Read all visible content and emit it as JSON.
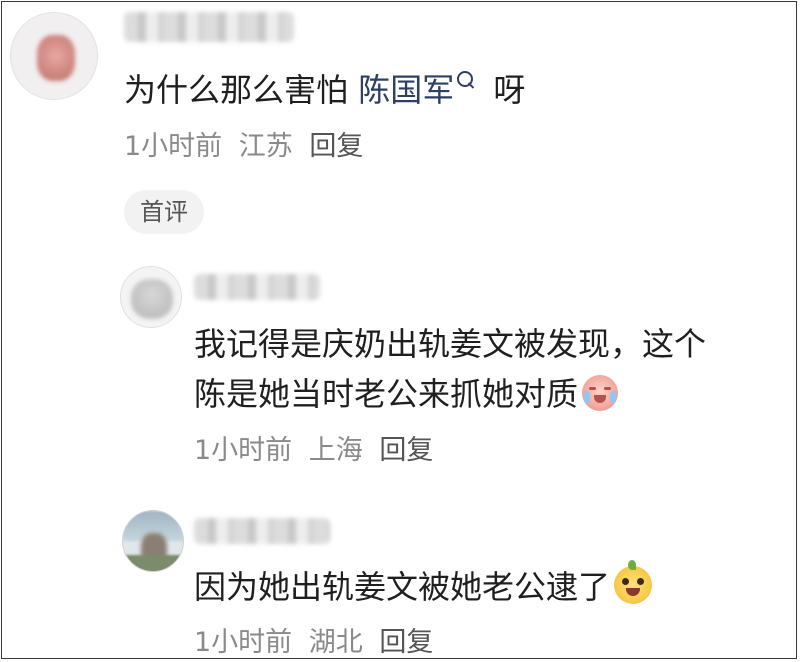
{
  "comments": [
    {
      "text_before_link": "为什么那么害怕 ",
      "link_text": "陈国军",
      "text_after_link": " 呀",
      "meta": {
        "time": "1小时前",
        "location": "江苏",
        "reply": "回复"
      },
      "badge": "首评"
    },
    {
      "line1": "我记得是庆奶出轨姜文被发现，这个",
      "line2": "陈是她当时老公来抓她对质",
      "emoji_icon": "crying-laughing-emoji-icon",
      "meta": {
        "time": "1小时前",
        "location": "上海",
        "reply": "回复"
      }
    },
    {
      "line1": "因为她出轨姜文被她老公逮了",
      "emoji_icon": "grinning-pear-emoji-icon",
      "meta": {
        "time": "1小时前",
        "location": "湖北",
        "reply": "回复"
      }
    }
  ],
  "colors": {
    "link": "#2d3f63",
    "meta": "#8a8a8a",
    "badge_bg": "#f2f2f2"
  }
}
